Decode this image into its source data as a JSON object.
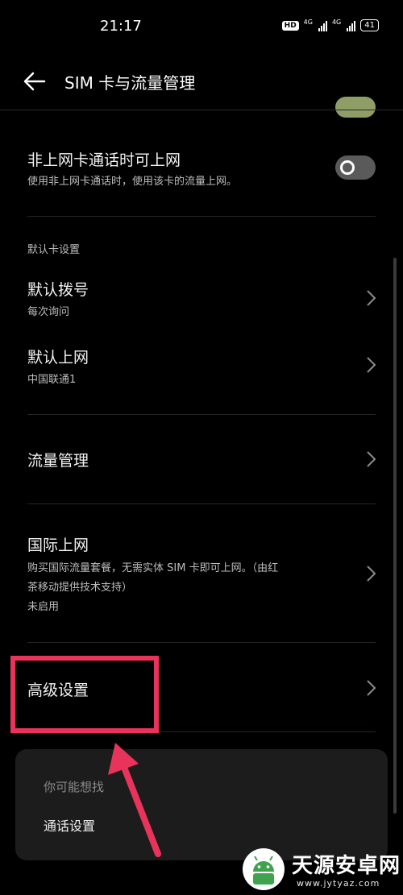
{
  "status_bar": {
    "time": "21:17",
    "hd_badge": "HD",
    "network_1": "4G",
    "network_2": "4G",
    "battery": "41"
  },
  "header": {
    "title": "SIM 卡与流量管理"
  },
  "rows": {
    "non_data_call": {
      "title": "非上网卡通话时可上网",
      "subtitle": "使用非上网卡通话时，使用该卡的流量上网。",
      "toggle_on": false
    },
    "default_card_section": "默认卡设置",
    "default_dial": {
      "title": "默认拨号",
      "subtitle": "每次询问"
    },
    "default_data": {
      "title": "默认上网",
      "subtitle": "中国联通1"
    },
    "data_management": {
      "title": "流量管理"
    },
    "international": {
      "title": "国际上网",
      "subtitle_line1": "购买国际流量套餐，无需实体 SIM 卡即可上网。（由红",
      "subtitle_line2": "茶移动提供技术支持）",
      "status": "未启用"
    },
    "advanced": {
      "title": "高级设置"
    }
  },
  "suggestions": {
    "heading": "你可能想找",
    "items": [
      "通话设置"
    ]
  },
  "annotation": {
    "color": "#e8345a"
  },
  "watermark": {
    "name": "天源安卓网",
    "url": "www.jytyaz.com"
  },
  "icons": {
    "back": "arrow-left-icon",
    "chevron": "chevron-right-icon",
    "watermark_logo": "android-logo-icon"
  }
}
